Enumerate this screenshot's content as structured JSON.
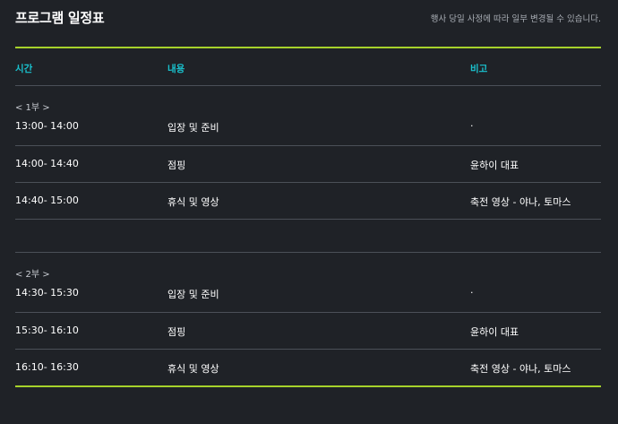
{
  "header": {
    "title": "프로그램 일정표",
    "notice": "행사 당일 사정에 따라 일부 변경될 수 있습니다."
  },
  "table": {
    "columns": [
      "시간",
      "내용",
      "비고"
    ]
  },
  "sections": [
    {
      "label": "< 1부 >",
      "rows": [
        {
          "time": "13:00- 14:00",
          "content": "입장 및 준비",
          "note": "·"
        },
        {
          "time": "14:00- 14:40",
          "content": "점핑",
          "note": "윤하이 대표"
        },
        {
          "time": "14:40- 15:00",
          "content": "휴식 및 영상",
          "note": "축전 영상 - 야나, 토마스"
        }
      ]
    },
    {
      "label": "< 2부 >",
      "rows": [
        {
          "time": "14:30- 15:30",
          "content": "입장 및 준비",
          "note": "·"
        },
        {
          "time": "15:30- 16:10",
          "content": "점핑",
          "note": "윤하이 대표"
        },
        {
          "time": "16:10- 16:30",
          "content": "휴식 및 영상",
          "note": "축전 영상 - 야나, 토마스"
        }
      ]
    }
  ],
  "colors": {
    "background": "#1f2227",
    "accent_line": "#a6d22b",
    "header_text": "#19c3cf",
    "divider": "#4b5058"
  }
}
